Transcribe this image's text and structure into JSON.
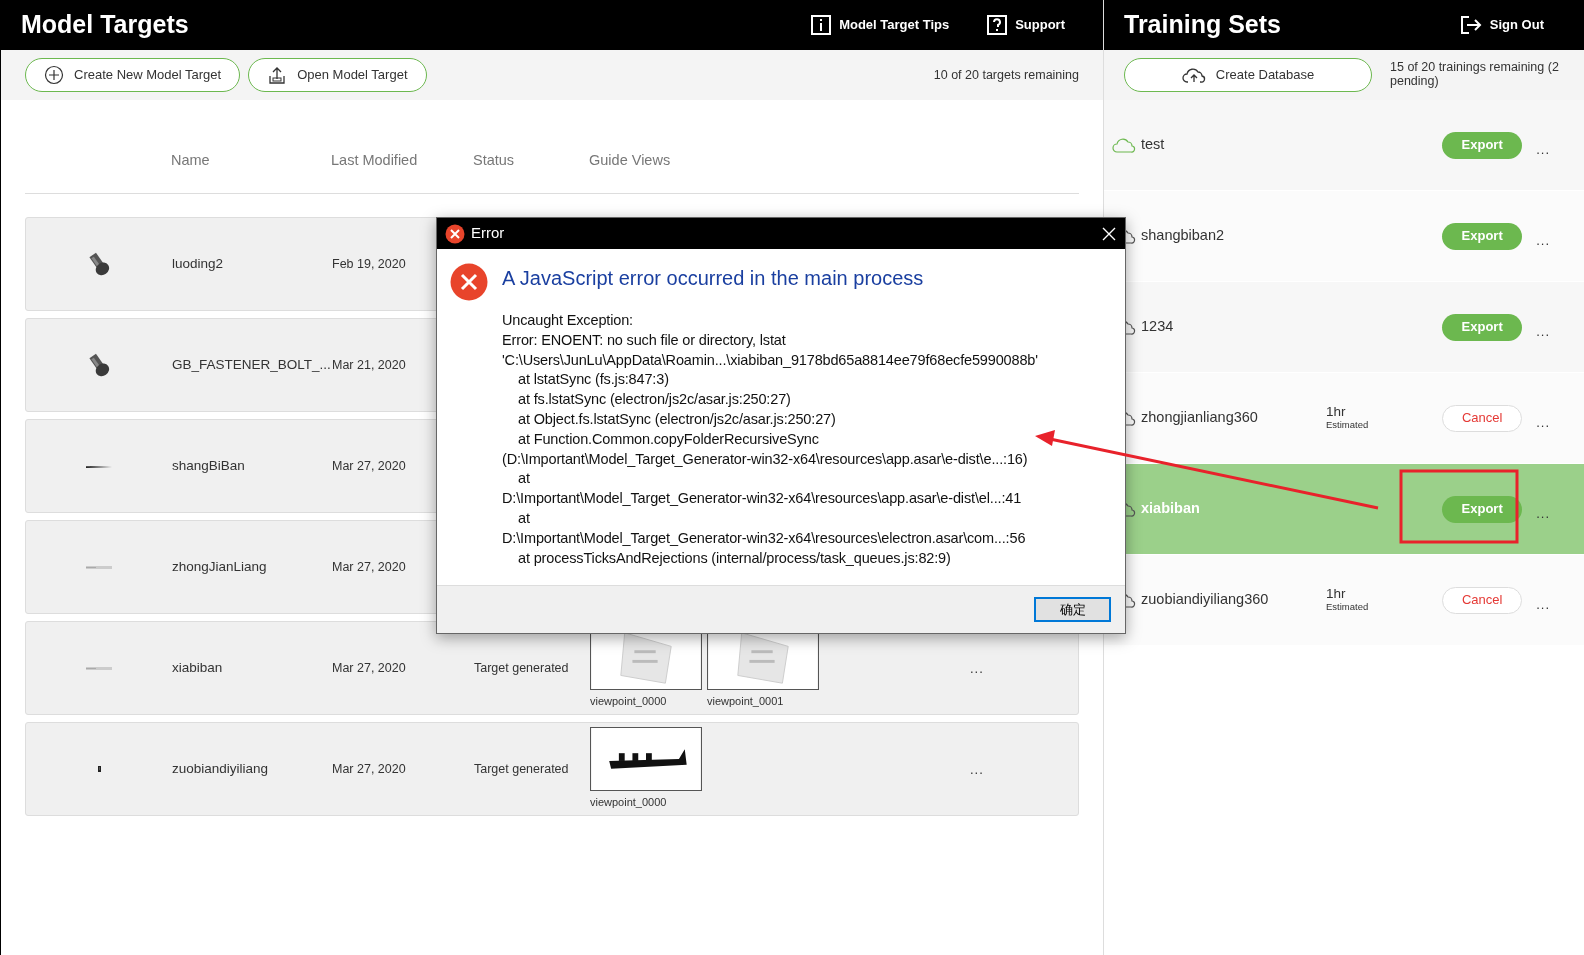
{
  "model_targets": {
    "title": "Model Targets",
    "header_links": [
      {
        "label": "Model Target Tips",
        "kind": "info"
      },
      {
        "label": "Support",
        "kind": "help"
      }
    ],
    "toolbar_buttons": [
      {
        "label": "Create New Model Target",
        "kind": "add"
      },
      {
        "label": "Open Model Target",
        "kind": "open"
      }
    ],
    "remaining": "10 of 20 targets remaining",
    "columns": [
      "Name",
      "Last Modified",
      "Status",
      "Guide Views"
    ],
    "rows": [
      {
        "name": "luoding2",
        "modified": "Feb 19, 2020"
      },
      {
        "name": "GB_FASTENER_BOLT_...",
        "modified": "Mar 21, 2020"
      },
      {
        "name": "shangBiBan",
        "modified": "Mar 27, 2020"
      },
      {
        "name": "zhongJianLiang",
        "modified": "Mar 27, 2020"
      },
      {
        "name": "xiabiban",
        "modified": "Mar 27, 2020",
        "status": "Target generated",
        "guide_views": [
          "viewpoint_0000",
          "viewpoint_0001"
        ],
        "menu": "..."
      },
      {
        "name": "zuobiandiyiliang",
        "modified": "Mar 27, 2020",
        "status": "Target generated",
        "guide_views": [
          "viewpoint_0000"
        ],
        "menu": "..."
      }
    ]
  },
  "training_sets": {
    "title": "Training Sets",
    "sign_out": "Sign Out",
    "create_button": "Create Database",
    "remaining": "15 of 20 trainings remaining (2 pending)",
    "rows": [
      {
        "name": "test",
        "action": "Export",
        "kind": "export",
        "menu": "...",
        "selected": false
      },
      {
        "name": "shangbiban2",
        "action": "Export",
        "kind": "export",
        "menu": "...",
        "selected": false
      },
      {
        "name": "1234",
        "action": "Export",
        "kind": "export",
        "menu": "...",
        "selected": false
      },
      {
        "name": "zhongjianliang360",
        "estimate": "1hr",
        "estimate_note": "Estimated",
        "action": "Cancel",
        "kind": "cancel",
        "menu": "...",
        "selected": false
      },
      {
        "name": "xiabiban",
        "action": "Export",
        "kind": "export",
        "menu": "...",
        "selected": true
      },
      {
        "name": "zuobiandiyiliang360",
        "estimate": "1hr",
        "estimate_note": "Estimated",
        "action": "Cancel",
        "kind": "cancel",
        "menu": "...",
        "selected": false
      }
    ]
  },
  "dialog": {
    "title": "Error",
    "heading": "A JavaScript error occurred in the main process",
    "lines": [
      {
        "text": "Uncaught Exception:",
        "indent": false
      },
      {
        "text": "Error: ENOENT: no such file or directory, lstat",
        "indent": false
      },
      {
        "text": "'C:\\Users\\JunLu\\AppData\\Roamin...\\xiabiban_9178bd65a8814ee79f68ecfe5990088b'",
        "indent": false
      },
      {
        "text": "at lstatSync (fs.js:847:3)",
        "indent": true
      },
      {
        "text": "at fs.lstatSync (electron/js2c/asar.js:250:27)",
        "indent": true
      },
      {
        "text": "at Object.fs.lstatSync (electron/js2c/asar.js:250:27)",
        "indent": true
      },
      {
        "text": "at Function.Common.copyFolderRecursiveSync",
        "indent": true
      },
      {
        "text": "(D:\\Important\\Model_Target_Generator-win32-x64\\resources\\app.asar\\e-dist\\e...:16)",
        "indent": false
      },
      {
        "text": "at",
        "indent": true
      },
      {
        "text": "D:\\Important\\Model_Target_Generator-win32-x64\\resources\\app.asar\\e-dist\\el...:41",
        "indent": false
      },
      {
        "text": "at",
        "indent": true
      },
      {
        "text": "D:\\Important\\Model_Target_Generator-win32-x64\\resources\\electron.asar\\com...:56",
        "indent": false
      },
      {
        "text": "at processTicksAndRejections (internal/process/task_queues.js:82:9)",
        "indent": true
      }
    ],
    "button": "确定"
  },
  "annotations": {
    "arrow": true,
    "highlight": true
  }
}
